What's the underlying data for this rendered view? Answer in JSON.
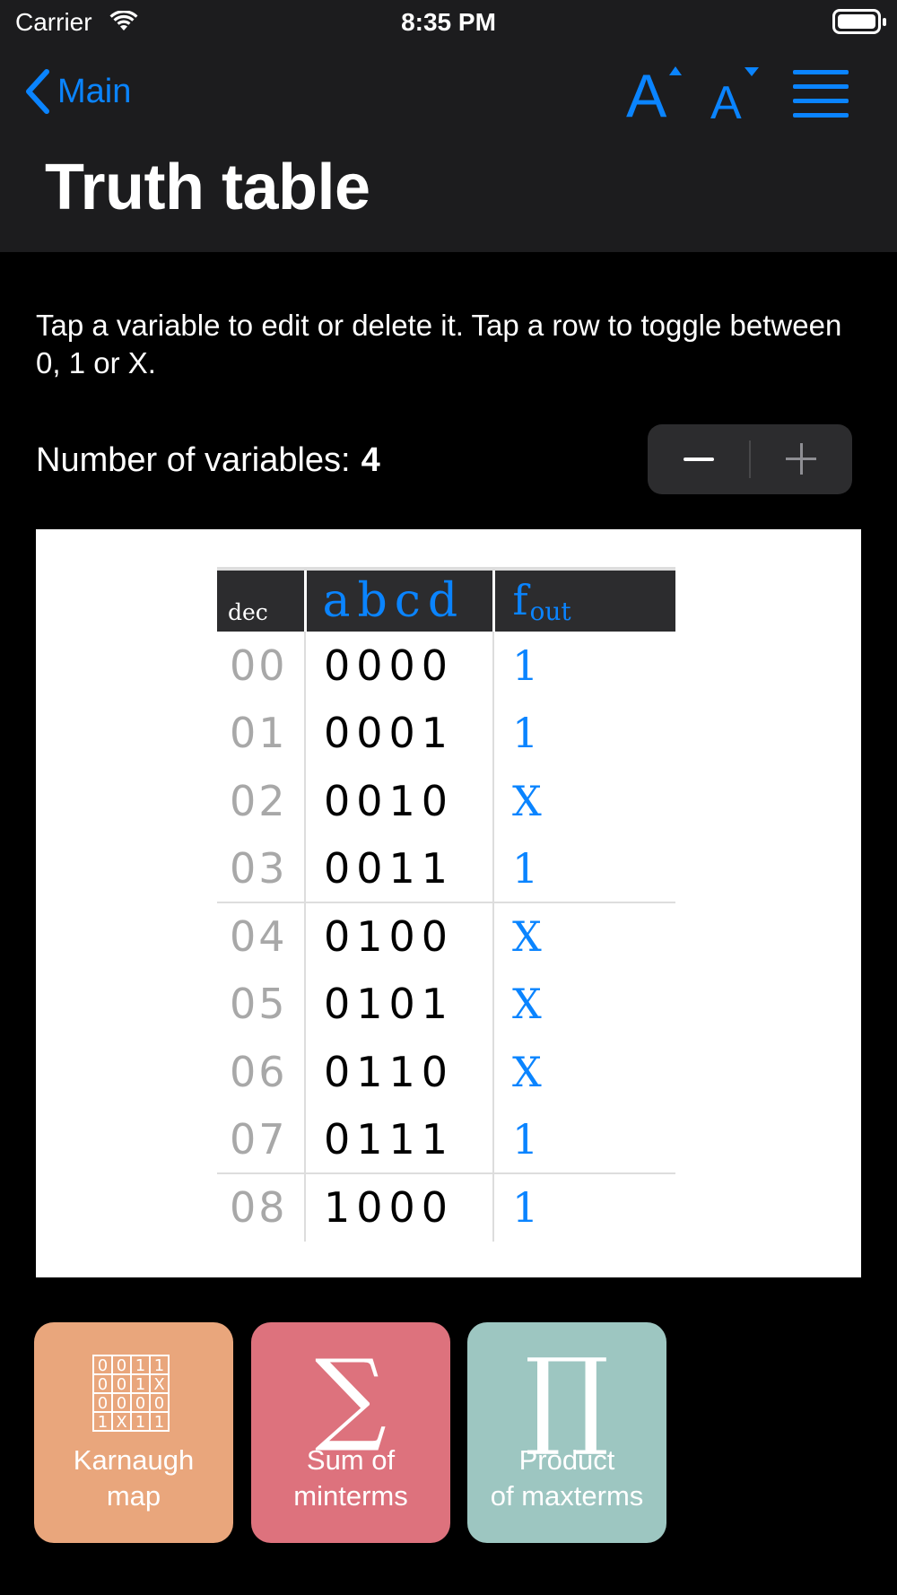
{
  "status_bar": {
    "carrier": "Carrier",
    "time": "8:35 PM"
  },
  "nav": {
    "back_label": "Main",
    "title": "Truth table",
    "icons": [
      "font-increase-icon",
      "font-decrease-icon",
      "menu-icon"
    ]
  },
  "instructions": "Tap a variable to edit or delete it. Tap a row to toggle between 0, 1 or X.",
  "variables": {
    "label": "Number of variables:",
    "count": "4"
  },
  "table": {
    "header": {
      "dec": "dec",
      "vars": "abcd",
      "out_main": "f",
      "out_sub": "out"
    },
    "rows": [
      {
        "dec": "00",
        "bits": "0000",
        "out": "1"
      },
      {
        "dec": "01",
        "bits": "0001",
        "out": "1"
      },
      {
        "dec": "02",
        "bits": "0010",
        "out": "X"
      },
      {
        "dec": "03",
        "bits": "0011",
        "out": "1"
      },
      {
        "dec": "04",
        "bits": "0100",
        "out": "X"
      },
      {
        "dec": "05",
        "bits": "0101",
        "out": "X"
      },
      {
        "dec": "06",
        "bits": "0110",
        "out": "X"
      },
      {
        "dec": "07",
        "bits": "0111",
        "out": "1"
      },
      {
        "dec": "08",
        "bits": "1000",
        "out": "1"
      }
    ]
  },
  "tiles": {
    "kmap": {
      "label_line1": "Karnaugh",
      "label_line2": "map",
      "color": "#e9a67c",
      "icon_grid": [
        [
          "0",
          "0",
          "1",
          "1"
        ],
        [
          "0",
          "0",
          "1",
          "X"
        ],
        [
          "0",
          "0",
          "0",
          "0"
        ],
        [
          "1",
          "X",
          "1",
          "1"
        ]
      ]
    },
    "sum": {
      "label_line1": "Sum of",
      "label_line2": "minterms",
      "glyph": "∑",
      "color": "#dd727d"
    },
    "product": {
      "label_line1": "Product",
      "label_line2": "of maxterms",
      "glyph": "∏",
      "color": "#9dc6c1"
    }
  },
  "colors": {
    "accent": "#0a84ff",
    "bar_bg": "#1c1c1e"
  }
}
